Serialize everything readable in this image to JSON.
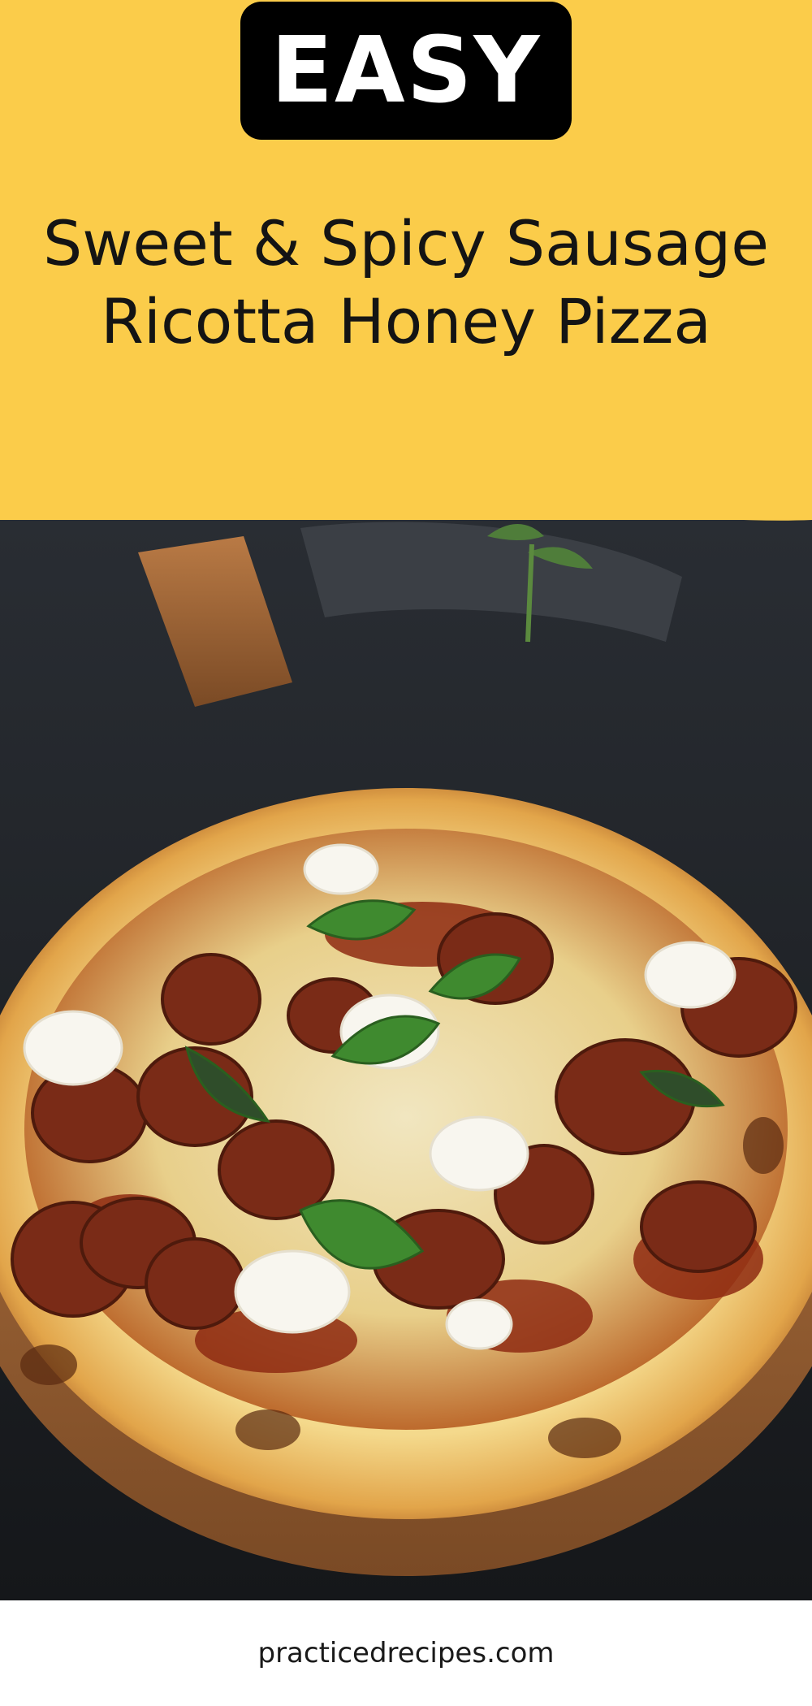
{
  "badge": {
    "label": "EASY"
  },
  "title": {
    "line1": "Sweet & Spicy Sausage",
    "line2": "Ricotta Honey Pizza"
  },
  "footer": {
    "site": "practicedrecipes.com"
  },
  "colors": {
    "banner": "#fbcc4a",
    "badge_bg": "#000000",
    "badge_text": "#ffffff",
    "title_text": "#141414"
  },
  "photo": {
    "subject": "sausage ricotta honey pizza with basil on wooden board"
  }
}
